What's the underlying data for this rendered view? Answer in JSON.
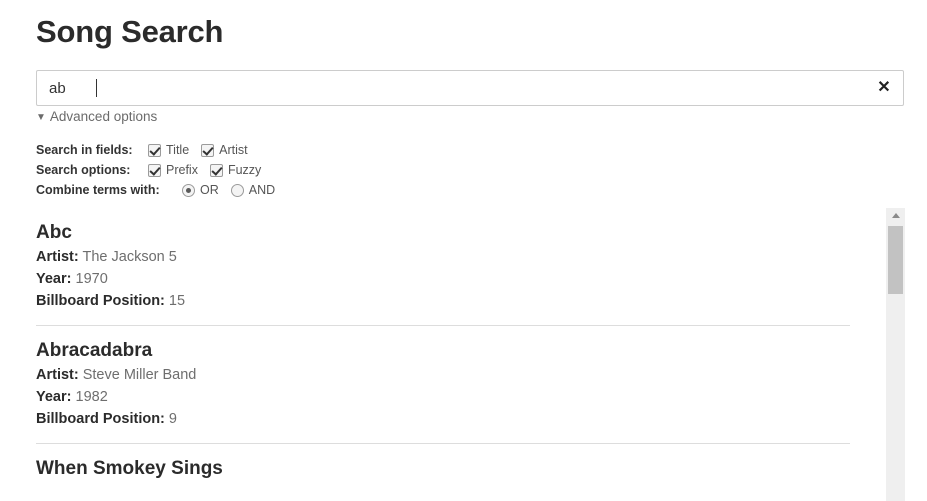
{
  "page": {
    "title": "Song Search"
  },
  "search": {
    "value": "ab",
    "placeholder": "",
    "clear_label": "✕"
  },
  "advanced": {
    "toggle_label": "Advanced options",
    "toggle_marker": "▼",
    "expanded": true,
    "rows": {
      "fields": {
        "label": "Search in fields:",
        "options": [
          {
            "label": "Title",
            "checked": true
          },
          {
            "label": "Artist",
            "checked": true
          }
        ]
      },
      "options": {
        "label": "Search options:",
        "options": [
          {
            "label": "Prefix",
            "checked": true
          },
          {
            "label": "Fuzzy",
            "checked": true
          }
        ]
      },
      "combine": {
        "label": "Combine terms with:",
        "options": [
          {
            "label": "OR",
            "selected": true
          },
          {
            "label": "AND",
            "selected": false
          }
        ]
      }
    }
  },
  "results": {
    "labels": {
      "artist": "Artist:",
      "year": "Year:",
      "position": "Billboard Position:"
    },
    "items": [
      {
        "title": "Abc",
        "artist": "The Jackson 5",
        "year": "1970",
        "position": "15"
      },
      {
        "title": "Abracadabra",
        "artist": "Steve Miller Band",
        "year": "1982",
        "position": "9"
      },
      {
        "title": "When Smokey Sings",
        "artist": "",
        "year": "",
        "position": ""
      }
    ]
  },
  "scrollbar": {
    "up_arrow": "▲"
  },
  "colors": {
    "text_dark": "#2b2b2b",
    "text_muted": "#6e6e6e",
    "border": "#cccccc",
    "divider": "#dddddd",
    "scroll_track": "#efefef",
    "scroll_thumb": "#c2c2c2"
  }
}
